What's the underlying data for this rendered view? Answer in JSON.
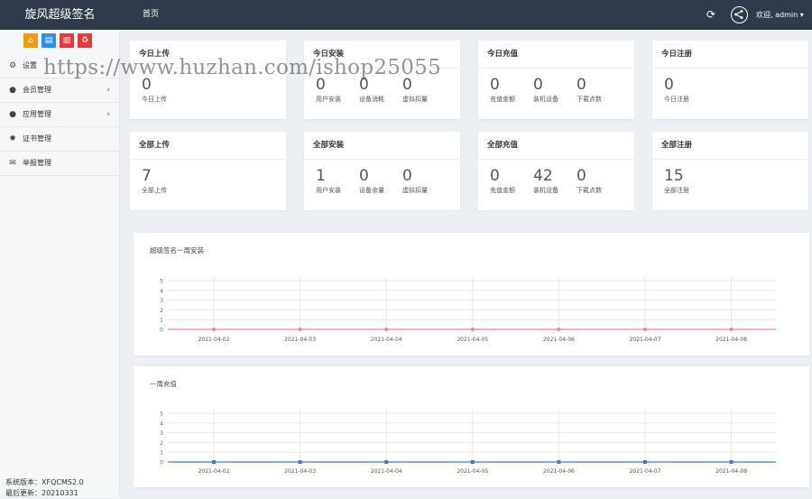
{
  "brand": {
    "title": "旋风超级签名"
  },
  "topnav": {
    "home": "首页",
    "welcome": "欢迎, admin ▾"
  },
  "quick_buttons": [
    {
      "icon": "home-icon",
      "glyph": "⌂",
      "color": "#f29b12"
    },
    {
      "icon": "document-icon",
      "glyph": "▤",
      "color": "#2f8fe0"
    },
    {
      "icon": "trash-icon",
      "glyph": "▥",
      "color": "#e23b3b"
    },
    {
      "icon": "recycle-icon",
      "glyph": "♻",
      "color": "#e23b3b"
    }
  ],
  "menu": [
    {
      "name": "settings",
      "icon": "gear-icon",
      "glyph": "⚙",
      "label": "设置",
      "arrow": ""
    },
    {
      "name": "members",
      "icon": "user-icon",
      "glyph": "●",
      "label": "会员管理",
      "arrow": "›"
    },
    {
      "name": "apps",
      "icon": "apple-icon",
      "glyph": "●",
      "label": "应用管理",
      "arrow": "›"
    },
    {
      "name": "certs",
      "icon": "certificate-icon",
      "glyph": "✹",
      "label": "证书管理",
      "arrow": ""
    },
    {
      "name": "reports",
      "icon": "envelope-icon",
      "glyph": "✉",
      "label": "举报管理",
      "arrow": ""
    }
  ],
  "system": {
    "version": "系统版本：XFQCMS2.0",
    "updated": "最后更新：20210331"
  },
  "watermark": "https://www.huzhan.com/ishop25055",
  "cards": [
    {
      "title": "今日上传",
      "stats": [
        {
          "value": "0",
          "label": "今日上传"
        }
      ]
    },
    {
      "title": "今日安装",
      "stats": [
        {
          "value": "0",
          "label": "用户安装"
        },
        {
          "value": "0",
          "label": "设备消耗"
        },
        {
          "value": "0",
          "label": "虚拟扣量"
        }
      ]
    },
    {
      "title": "今日充值",
      "stats": [
        {
          "value": "0",
          "label": "充值金额"
        },
        {
          "value": "0",
          "label": "装机设备"
        },
        {
          "value": "0",
          "label": "下载点数"
        }
      ]
    },
    {
      "title": "今日注册",
      "stats": [
        {
          "value": "0",
          "label": "今日注册"
        }
      ]
    },
    {
      "title": "全部上传",
      "stats": [
        {
          "value": "7",
          "label": "全部上传"
        }
      ]
    },
    {
      "title": "全部安装",
      "stats": [
        {
          "value": "1",
          "label": "用户安装"
        },
        {
          "value": "0",
          "label": "设备余量"
        },
        {
          "value": "0",
          "label": "虚拟扣量"
        }
      ]
    },
    {
      "title": "全部充值",
      "stats": [
        {
          "value": "0",
          "label": "充值金额"
        },
        {
          "value": "42",
          "label": "装机设备"
        },
        {
          "value": "0",
          "label": "下载点数"
        }
      ]
    },
    {
      "title": "全部注册",
      "stats": [
        {
          "value": "15",
          "label": "全部注册"
        }
      ]
    }
  ],
  "chart_data": [
    {
      "type": "line",
      "title": "超级签名一周安装",
      "x": [
        "2021-04-02",
        "2021-04-03",
        "2021-04-04",
        "2021-04-05",
        "2021-04-06",
        "2021-04-07",
        "2021-04-08"
      ],
      "series": [
        {
          "values": [
            0,
            0,
            0,
            0,
            0,
            0,
            0
          ],
          "color": "#e97fb6"
        }
      ],
      "yticks": [
        0,
        1,
        2,
        3,
        4,
        5
      ],
      "ylim": [
        0,
        5
      ],
      "grid": true
    },
    {
      "type": "line",
      "title": "一周充值",
      "x": [
        "2021-04-02",
        "2021-04-03",
        "2021-04-04",
        "2021-04-05",
        "2021-04-06",
        "2021-04-07",
        "2021-04-08"
      ],
      "series": [
        {
          "values": [
            0,
            0,
            0,
            0,
            0,
            0,
            0
          ],
          "color": "#3a7bc8"
        }
      ],
      "yticks": [
        0,
        1,
        2,
        3,
        4,
        5
      ],
      "ylim": [
        0,
        5
      ],
      "grid": true
    }
  ]
}
